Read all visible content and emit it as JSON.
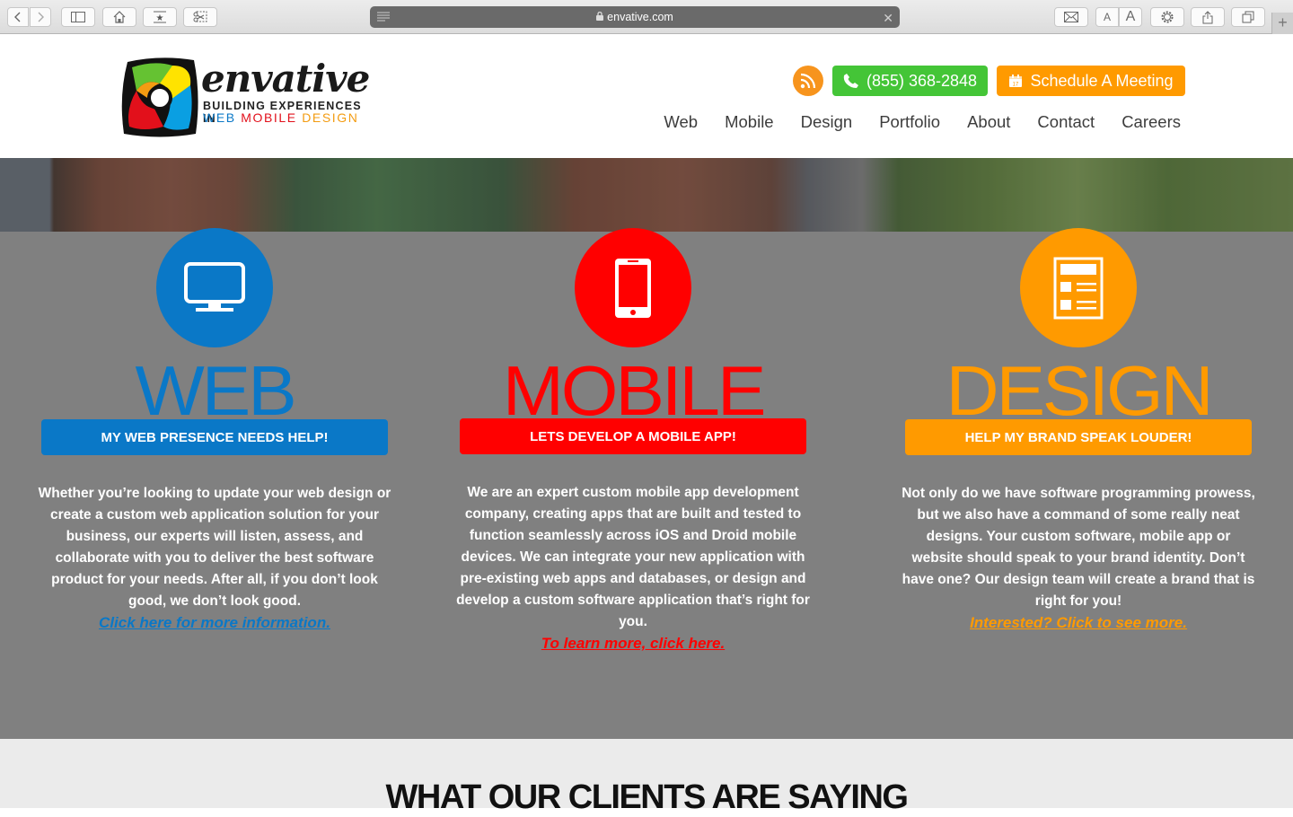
{
  "browser": {
    "url": "envative.com",
    "buttons": {
      "back": "back-icon",
      "forward": "forward-icon",
      "sidebar": "sidebar-icon",
      "home": "home-icon",
      "bookmarks": "bookmarks-icon",
      "clip": "clip-icon",
      "mail": "mail-icon",
      "font_small": "A",
      "font_large": "A",
      "settings": "gear-icon",
      "share": "share-icon",
      "tabs": "tabs-icon",
      "new_tab": "+"
    }
  },
  "header": {
    "logo": {
      "wordmark": "envative",
      "tagline": "BUILDING EXPERIENCES IN",
      "tag_web": "WEB",
      "tag_mobile": "MOBILE",
      "tag_design": "DESIGN"
    },
    "phone": "(855) 368-2848",
    "schedule": "Schedule A Meeting",
    "nav": [
      "Web",
      "Mobile",
      "Design",
      "Portfolio",
      "About",
      "Contact",
      "Careers"
    ],
    "colors": {
      "rss": "#f7941d",
      "phone": "#44c537",
      "schedule": "#ff9a00"
    }
  },
  "services": [
    {
      "title": "WEB",
      "icon": "monitor-icon",
      "cta": "MY WEB PRESENCE NEEDS HELP!",
      "description": "Whether you’re looking to update your web design or create a custom web application solution for your business, our experts will listen, assess, and collaborate with you to deliver the best software product for your needs. After all, if you don’t look good, we don’t look good.",
      "link": "Click here for more information.",
      "color": "#0a78c7"
    },
    {
      "title": "MOBILE",
      "icon": "smartphone-icon",
      "cta": "LETS DEVELOP A MOBILE APP!",
      "description": "We are an expert custom mobile app development company, creating apps that are built and tested to function seamlessly across iOS and Droid mobile devices. We can integrate your new application with pre-existing web apps and databases, or design and develop a custom software application that’s right for you.",
      "link": "To learn more, click here.",
      "color": "#ff0000"
    },
    {
      "title": "DESIGN",
      "icon": "layout-icon",
      "cta": "HELP MY BRAND SPEAK LOUDER!",
      "description": "Not only do we have software programming prowess, but we also have a command of some really neat designs. Your custom software, mobile app or website should speak to your brand identity. Don’t have one? Our design team will create a brand that is right for you!",
      "link": "Interested? Click to see more.",
      "color": "#ff9a00"
    }
  ],
  "clients": {
    "heading": "WHAT OUR CLIENTS ARE SAYING"
  }
}
